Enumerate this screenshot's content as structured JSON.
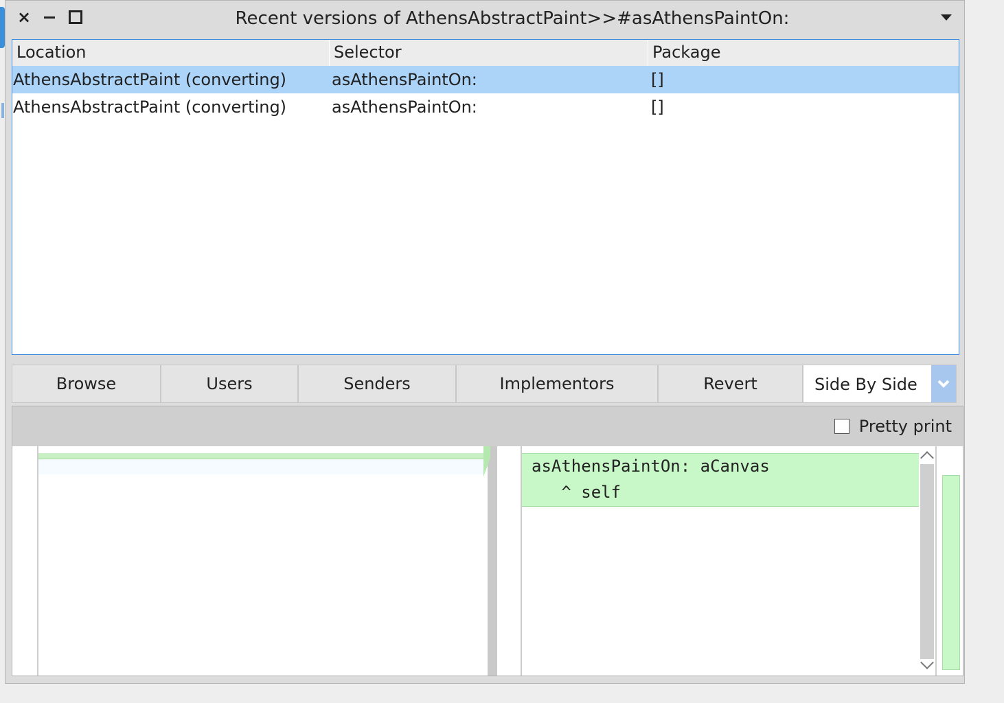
{
  "window": {
    "title": "Recent versions of AthensAbstractPaint>>#asAthensPaintOn:",
    "close_glyph": "×"
  },
  "table": {
    "columns": [
      "Location",
      "Selector",
      "Package"
    ],
    "rows": [
      {
        "location": "AthensAbstractPaint (converting)",
        "selector": "asAthensPaintOn:",
        "package": "[]",
        "selected": true
      },
      {
        "location": "AthensAbstractPaint (converting)",
        "selector": "asAthensPaintOn:",
        "package": "[]",
        "selected": false
      }
    ]
  },
  "toolbar": {
    "browse": "Browse",
    "users": "Users",
    "senders": "Senders",
    "implementors": "Implementors",
    "revert": "Revert",
    "view_mode": "Side By Side"
  },
  "diff": {
    "pretty_print_label": "Pretty print",
    "pretty_print_checked": false,
    "right_lines": [
      "asAthensPaintOn: aCanvas",
      "   ^ self"
    ]
  },
  "colors": {
    "selection": "#acd3f8",
    "diff_added": "#c8f8c8",
    "focus_border": "#3d8ae0"
  }
}
